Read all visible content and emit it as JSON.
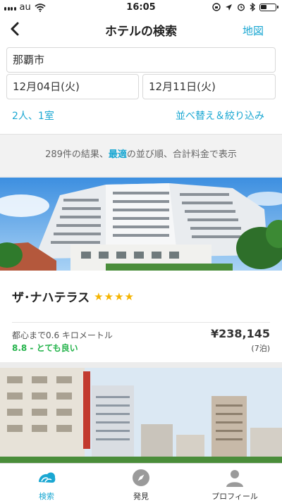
{
  "status_bar": {
    "carrier": "au",
    "time": "16:05"
  },
  "nav": {
    "title": "ホテルの検索",
    "map_label": "地図"
  },
  "search": {
    "city": "那覇市",
    "checkin": "12月04日(火)",
    "checkout": "12月11日(火)",
    "guests": "2人、1室",
    "sort_filter": "並べ替え＆絞り込み"
  },
  "summary": {
    "count_text": "289件の結果、",
    "sort_name": "最適",
    "rest_text": "の並び順、合計料金で表示"
  },
  "hotel": {
    "name": "ザ･ナハテラス",
    "stars": 4,
    "stars_text": "★★★★",
    "distance": "都心まで0.6 キロメートル",
    "rating": "8.8 - とても良い",
    "price": "¥238,145",
    "nights": "(7泊)"
  },
  "tabs": [
    {
      "label": "検索",
      "icon": "search-icon",
      "active": true
    },
    {
      "label": "発見",
      "icon": "compass-icon",
      "active": false
    },
    {
      "label": "プロフィール",
      "icon": "profile-icon",
      "active": false
    }
  ],
  "colors": {
    "accent": "#1aa7d2",
    "rating_green": "#24b34b",
    "star": "#f5b400"
  }
}
